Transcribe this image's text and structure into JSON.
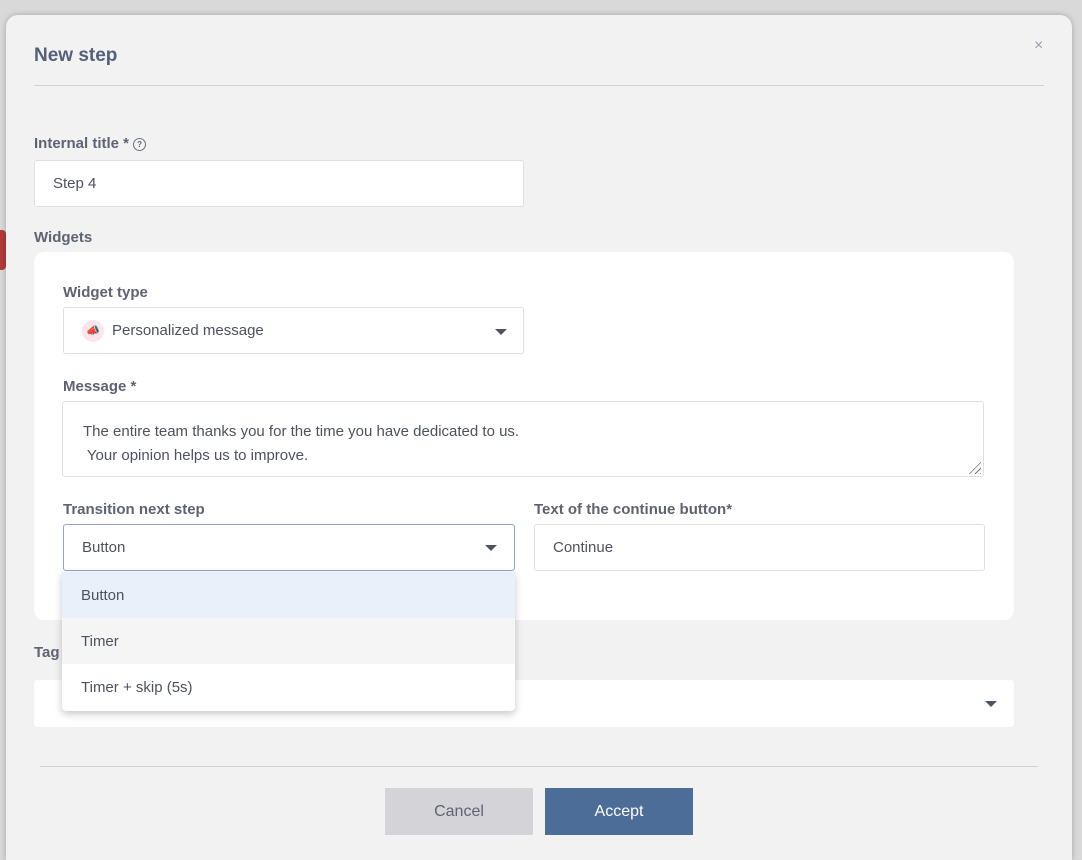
{
  "modal": {
    "title": "New step",
    "close_glyph": "×"
  },
  "internal_title": {
    "label": "Internal title *",
    "help_glyph": "?",
    "value": "Step 4"
  },
  "widgets": {
    "label": "Widgets",
    "widget_type": {
      "label": "Widget type",
      "value": "Personalized message",
      "icon": "megaphone-icon"
    },
    "message": {
      "label": "Message *",
      "line1": "The entire  team thanks you for the time you have dedicated to us.",
      "line2": " Your opinion helps us to improve."
    },
    "transition": {
      "label": "Transition next step",
      "value": "Button",
      "options": [
        "Button",
        "Timer",
        "Timer + skip (5s)"
      ]
    },
    "continue_text": {
      "label": "Text of the continue button*",
      "value": "Continue"
    }
  },
  "tags": {
    "label": "Tag"
  },
  "footer": {
    "cancel_label": "Cancel",
    "accept_label": "Accept"
  },
  "colors": {
    "accent": "#4c6d98",
    "selected_option_bg": "#e8f0f9"
  }
}
